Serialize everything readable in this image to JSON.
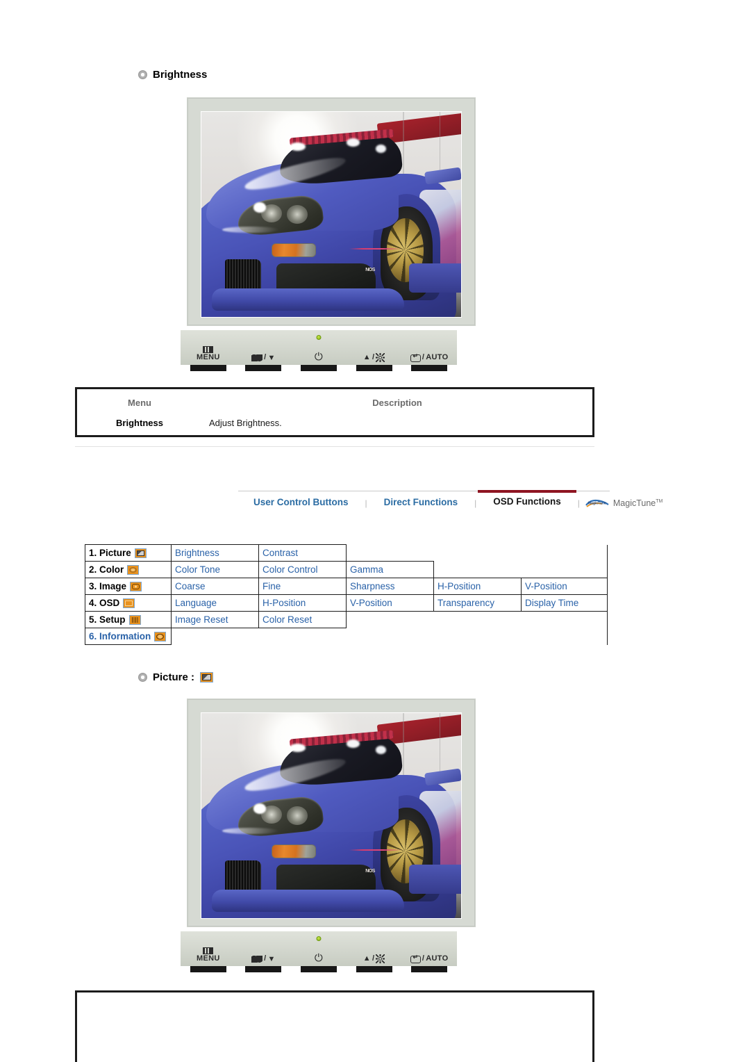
{
  "sections": {
    "brightness_heading": "Brightness",
    "picture_heading": "Picture :"
  },
  "description_table": {
    "headers": [
      "Menu",
      "Description"
    ],
    "rows": [
      {
        "menu": "Brightness",
        "description": "Adjust Brightness."
      }
    ]
  },
  "nav_tabs": {
    "items": [
      {
        "label": "User Control Buttons",
        "active": false
      },
      {
        "label": "Direct Functions",
        "active": false
      },
      {
        "label": "OSD Functions",
        "active": true
      }
    ],
    "separator": "|",
    "magictune": {
      "label": "MagicTune",
      "trademark": "TM",
      "logo_text": "MagicTune"
    },
    "active_underline_color": "#8e1421",
    "link_color": "#2b6ca3"
  },
  "osd_table": {
    "link_color": "#2a62a8",
    "rows": [
      {
        "category": "1. Picture",
        "icon": "picture-icon",
        "category_is_link": false,
        "items": [
          "Brightness",
          "Contrast"
        ]
      },
      {
        "category": "2. Color",
        "icon": "color-icon",
        "category_is_link": false,
        "items": [
          "Color Tone",
          "Color Control",
          "Gamma"
        ]
      },
      {
        "category": "3. Image",
        "icon": "image-icon",
        "category_is_link": false,
        "items": [
          "Coarse",
          "Fine",
          "Sharpness",
          "H-Position",
          "V-Position"
        ]
      },
      {
        "category": "4. OSD",
        "icon": "osd-icon",
        "category_is_link": false,
        "items": [
          "Language",
          "H-Position",
          "V-Position",
          "Transparency",
          "Display Time"
        ]
      },
      {
        "category": "5. Setup",
        "icon": "setup-icon",
        "category_is_link": false,
        "items": [
          "Image Reset",
          "Color Reset"
        ]
      },
      {
        "category": "6. Information",
        "icon": "information-icon",
        "category_is_link": true,
        "items": []
      }
    ]
  },
  "monitor": {
    "screen_content": "blue-sports-car-photo",
    "bezel_color": "#d6dad3",
    "controls": [
      {
        "name": "menu-button",
        "icon": "menu-icon",
        "label": "MENU"
      },
      {
        "name": "contrast-down-button",
        "icon": "contrast-icon",
        "separator": "/",
        "arrow": "▼"
      },
      {
        "name": "power-button",
        "icon": "power-icon",
        "label": ""
      },
      {
        "name": "brightness-up-button",
        "arrow": "▲",
        "separator": "/",
        "icon": "sun-icon"
      },
      {
        "name": "enter-auto-button",
        "icon": "enter-icon",
        "separator": "/",
        "label": "AUTO"
      }
    ],
    "power_led_color": "#9fce22"
  }
}
